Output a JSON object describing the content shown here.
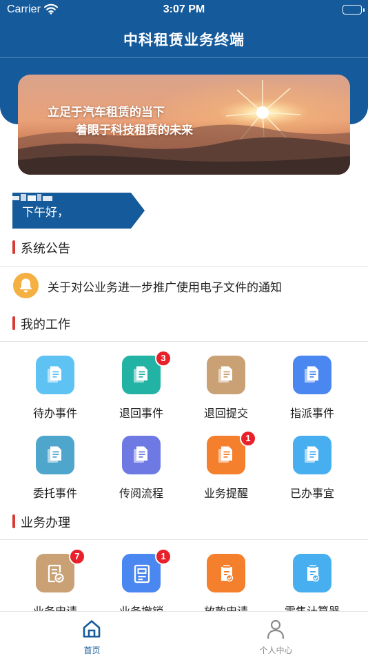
{
  "status_bar": {
    "carrier": "Carrier",
    "time": "3:07 PM"
  },
  "header": {
    "title": "中科租赁业务终端"
  },
  "banner": {
    "line1": "立足于汽车租赁的当下",
    "line2": "着眼于科技租赁的未来"
  },
  "greeting": {
    "text": "下午好，"
  },
  "announcement": {
    "section_title": "系统公告",
    "notice": "关于对公业务进一步推广使用电子文件的通知"
  },
  "my_work": {
    "section_title": "我的工作",
    "items": [
      {
        "label": "待办事件",
        "color": "#5ec3f3",
        "badge": ""
      },
      {
        "label": "退回事件",
        "color": "#22b3a4",
        "badge": "3"
      },
      {
        "label": "退回提交",
        "color": "#caa174",
        "badge": ""
      },
      {
        "label": "指派事件",
        "color": "#4b87f0",
        "badge": ""
      },
      {
        "label": "委托事件",
        "color": "#4fa6cd",
        "badge": ""
      },
      {
        "label": "传阅流程",
        "color": "#6f79e4",
        "badge": ""
      },
      {
        "label": "业务提醒",
        "color": "#f47f2d",
        "badge": "1"
      },
      {
        "label": "已办事宜",
        "color": "#47aef0",
        "badge": ""
      }
    ]
  },
  "business": {
    "section_title": "业务办理",
    "items": [
      {
        "label": "业务申请",
        "color": "#caa174",
        "badge": "7"
      },
      {
        "label": "业务撤销",
        "color": "#4b87f0",
        "badge": "1"
      },
      {
        "label": "放款申请",
        "color": "#f47f2d",
        "badge": ""
      },
      {
        "label": "零售计算器",
        "color": "#47aef0",
        "badge": ""
      }
    ]
  },
  "tabbar": {
    "home": {
      "label": "首页",
      "icon": "home-icon"
    },
    "profile": {
      "label": "个人中心",
      "icon": "person-icon"
    },
    "active_color": "#155a9b",
    "inactive_color": "#8a8a8a"
  }
}
